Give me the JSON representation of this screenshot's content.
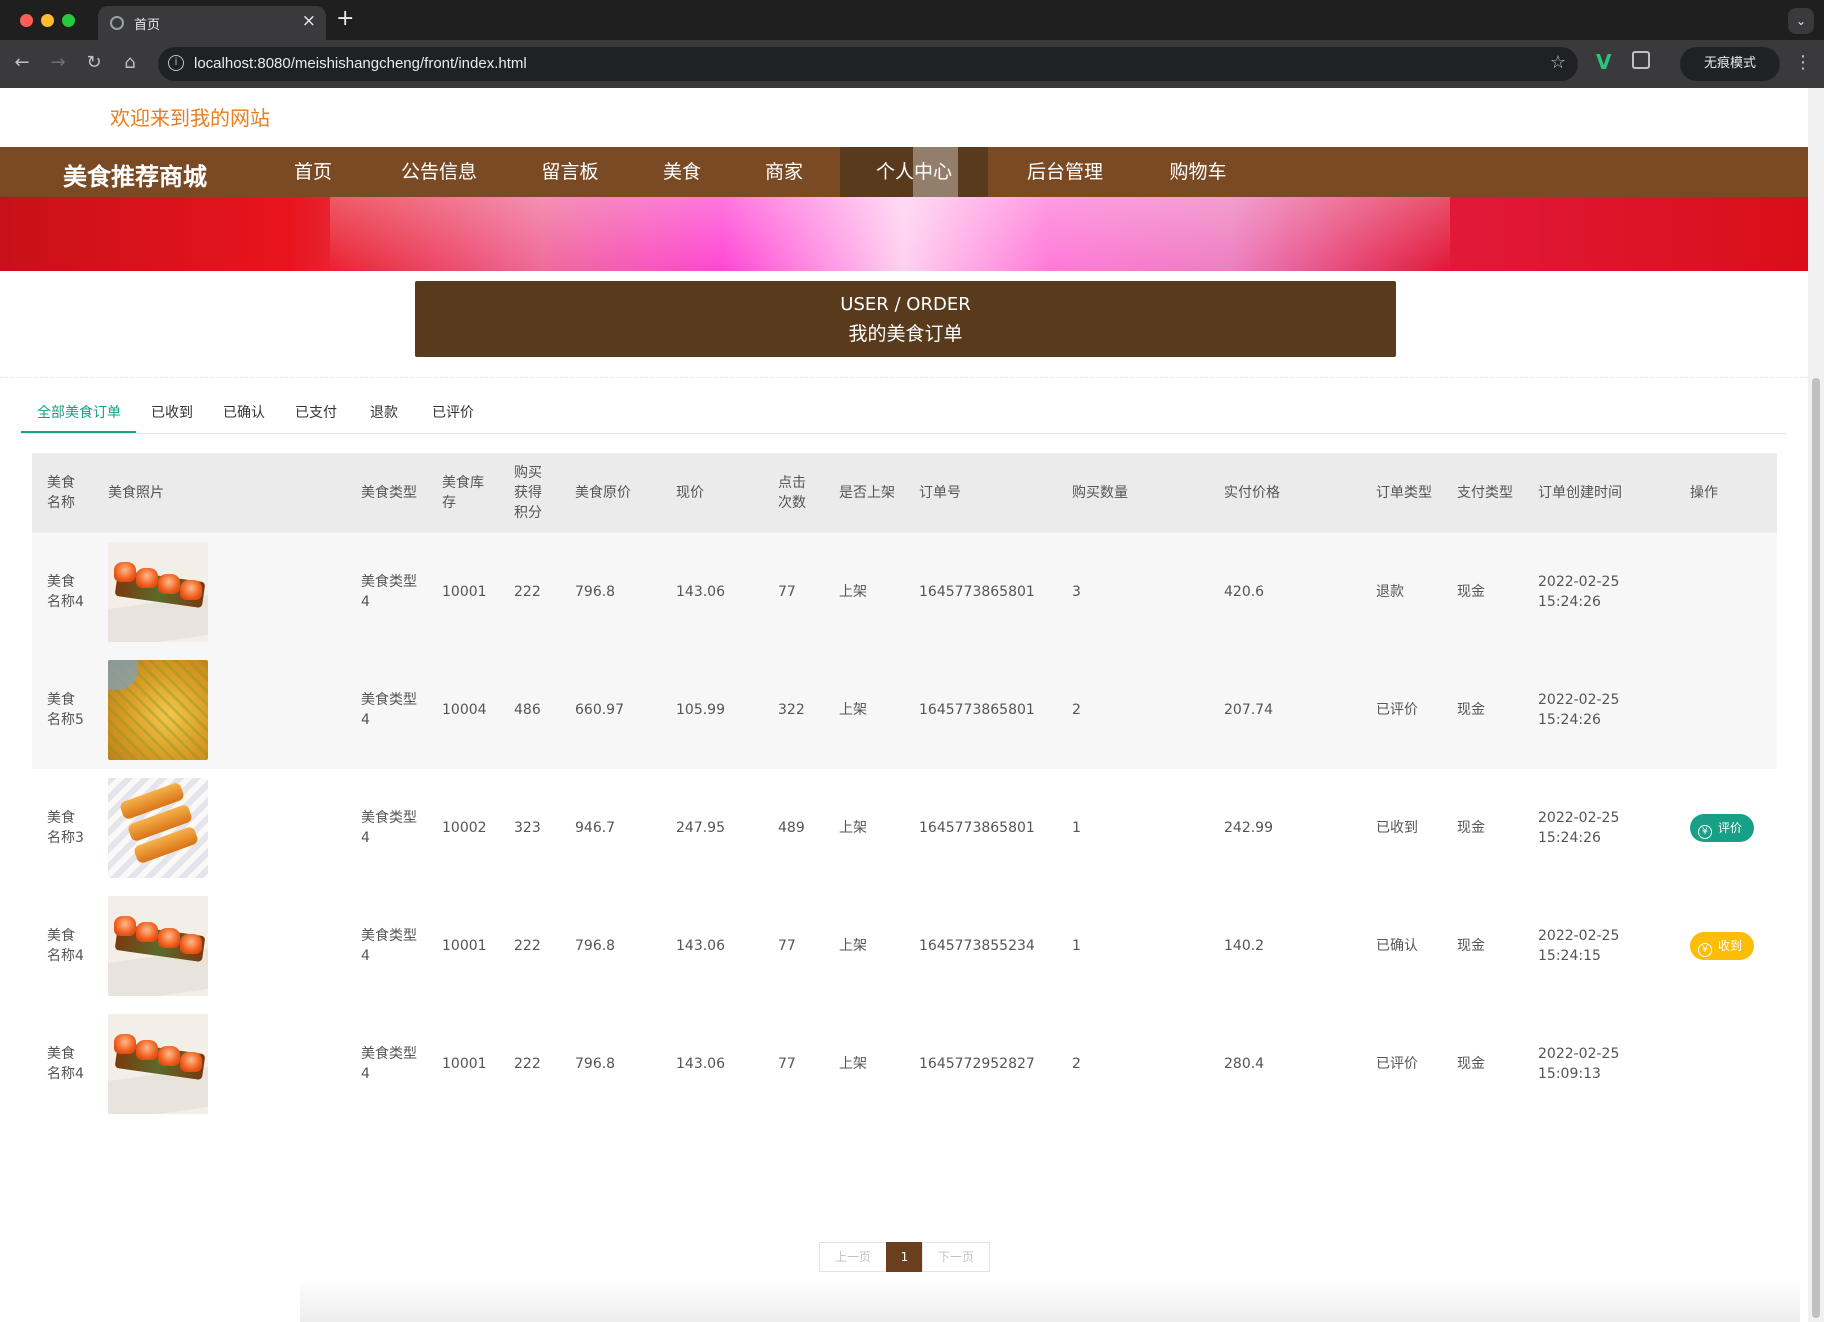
{
  "browser": {
    "tab_title": "首页",
    "url": "localhost:8080/meishishangcheng/front/index.html",
    "incognito_label": "无痕模式"
  },
  "site": {
    "welcome": "欢迎来到我的网站",
    "brand": "美食推荐商城",
    "nav": [
      "首页",
      "公告信息",
      "留言板",
      "美食",
      "商家",
      "个人中心",
      "后台管理",
      "购物车"
    ],
    "active_nav": "个人中心"
  },
  "section": {
    "title_en": "USER / ORDER",
    "title_cn": "我的美食订单"
  },
  "tabs": [
    "全部美食订单",
    "已收到",
    "已确认",
    "已支付",
    "退款",
    "已评价"
  ],
  "active_tab": "全部美食订单",
  "table": {
    "headers": [
      "美食名称",
      "美食照片",
      "美食类型",
      "美食库存",
      "购买获得积分",
      "美食原价",
      "现价",
      "点击次数",
      "是否上架",
      "订单号",
      "购买数量",
      "实付价格",
      "订单类型",
      "支付类型",
      "订单创建时间",
      "操作"
    ],
    "rows": [
      {
        "name": "美食名称4",
        "photo": "sushi-photo",
        "type": "美食类型4",
        "stock": "10001",
        "points": "222",
        "orig_price": "796.8",
        "price": "143.06",
        "clicks": "77",
        "on_sale": "上架",
        "order_no": "1645773865801",
        "qty": "3",
        "paid": "420.6",
        "order_type": "退款",
        "pay_type": "现金",
        "date": "2022-02-25",
        "time": "15:24:26",
        "action": ""
      },
      {
        "name": "美食名称5",
        "photo": "grilled-dish-photo",
        "type": "美食类型4",
        "stock": "10004",
        "points": "486",
        "orig_price": "660.97",
        "price": "105.99",
        "clicks": "322",
        "on_sale": "上架",
        "order_no": "1645773865801",
        "qty": "2",
        "paid": "207.74",
        "order_type": "已评价",
        "pay_type": "现金",
        "date": "2022-02-25",
        "time": "15:24:26",
        "action": ""
      },
      {
        "name": "美食名称3",
        "photo": "pastry-photo",
        "type": "美食类型4",
        "stock": "10002",
        "points": "323",
        "orig_price": "946.7",
        "price": "247.95",
        "clicks": "489",
        "on_sale": "上架",
        "order_no": "1645773865801",
        "qty": "1",
        "paid": "242.99",
        "order_type": "已收到",
        "pay_type": "现金",
        "date": "2022-02-25",
        "time": "15:24:26",
        "action": "评价"
      },
      {
        "name": "美食名称4",
        "photo": "sushi-photo",
        "type": "美食类型4",
        "stock": "10001",
        "points": "222",
        "orig_price": "796.8",
        "price": "143.06",
        "clicks": "77",
        "on_sale": "上架",
        "order_no": "1645773855234",
        "qty": "1",
        "paid": "140.2",
        "order_type": "已确认",
        "pay_type": "现金",
        "date": "2022-02-25",
        "time": "15:24:15",
        "action": "收到"
      },
      {
        "name": "美食名称4",
        "photo": "sushi-photo",
        "type": "美食类型4",
        "stock": "10001",
        "points": "222",
        "orig_price": "796.8",
        "price": "143.06",
        "clicks": "77",
        "on_sale": "上架",
        "order_no": "1645772952827",
        "qty": "2",
        "paid": "280.4",
        "order_type": "已评价",
        "pay_type": "现金",
        "date": "2022-02-25",
        "time": "15:09:13",
        "action": ""
      }
    ]
  },
  "pager": {
    "prev": "上一页",
    "current": "1",
    "next": "下一页"
  },
  "colors": {
    "nav_bg": "#7a4a25",
    "title_bg": "#5a3a1d",
    "accent_green": "#17a085",
    "price_red": "#e0141c",
    "receive_yellow": "#fbbd08",
    "welcome_orange": "#e67e22"
  }
}
